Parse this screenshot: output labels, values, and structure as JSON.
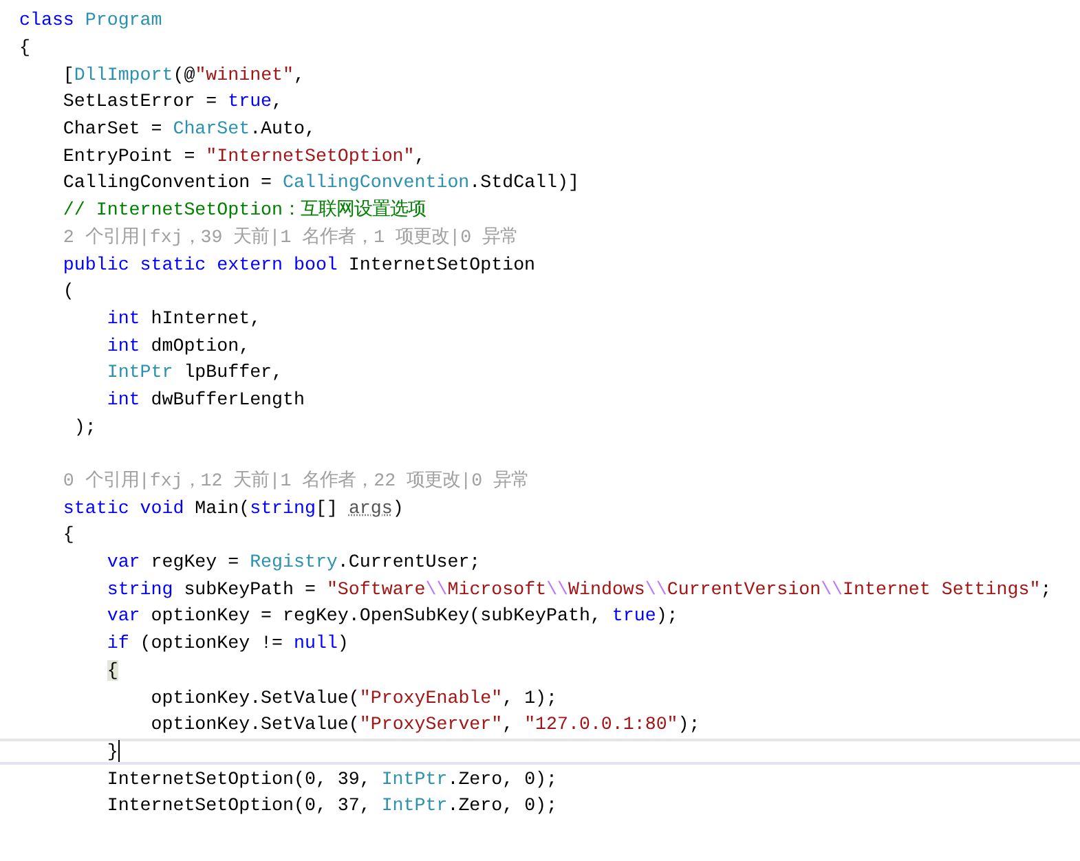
{
  "code_lines": [
    {
      "kind": "code",
      "current": false,
      "tokens": [
        {
          "t": "class",
          "kind": "keyword"
        },
        {
          "t": " Program",
          "kind": "type"
        }
      ]
    },
    {
      "kind": "code",
      "current": false,
      "tokens": [
        {
          "t": "{",
          "kind": "plain"
        }
      ]
    },
    {
      "kind": "code",
      "current": false,
      "tokens": [
        {
          "t": "    [",
          "kind": "plain"
        },
        {
          "t": "DllImport",
          "kind": "type"
        },
        {
          "t": "(@",
          "kind": "plain"
        },
        {
          "t": "\"wininet\"",
          "kind": "string"
        },
        {
          "t": ",",
          "kind": "plain"
        }
      ]
    },
    {
      "kind": "code",
      "current": false,
      "tokens": [
        {
          "t": "    SetLastError = ",
          "kind": "plain"
        },
        {
          "t": "true",
          "kind": "keyword"
        },
        {
          "t": ",",
          "kind": "plain"
        }
      ]
    },
    {
      "kind": "code",
      "current": false,
      "tokens": [
        {
          "t": "    CharSet = ",
          "kind": "plain"
        },
        {
          "t": "CharSet",
          "kind": "type"
        },
        {
          "t": ".Auto,",
          "kind": "plain"
        }
      ]
    },
    {
      "kind": "code",
      "current": false,
      "tokens": [
        {
          "t": "    EntryPoint = ",
          "kind": "plain"
        },
        {
          "t": "\"InternetSetOption\"",
          "kind": "string"
        },
        {
          "t": ",",
          "kind": "plain"
        }
      ]
    },
    {
      "kind": "code",
      "current": false,
      "tokens": [
        {
          "t": "    CallingConvention = ",
          "kind": "plain"
        },
        {
          "t": "CallingConvention",
          "kind": "type"
        },
        {
          "t": ".StdCall)]",
          "kind": "plain"
        }
      ]
    },
    {
      "kind": "code",
      "current": false,
      "tokens": [
        {
          "t": "    // InternetSetOption：互联网设置选项",
          "kind": "comment"
        }
      ]
    },
    {
      "kind": "lens",
      "current": false,
      "text": "    2 个引用|fxj，39 天前|1 名作者，1 项更改|0 异常"
    },
    {
      "kind": "code",
      "current": false,
      "tokens": [
        {
          "t": "    public static extern bool",
          "kind": "keyword"
        },
        {
          "t": " InternetSetOption",
          "kind": "plain"
        }
      ]
    },
    {
      "kind": "code",
      "current": false,
      "tokens": [
        {
          "t": "    (",
          "kind": "plain"
        }
      ]
    },
    {
      "kind": "code",
      "current": false,
      "tokens": [
        {
          "t": "        int",
          "kind": "keyword"
        },
        {
          "t": " hInternet,",
          "kind": "plain"
        }
      ]
    },
    {
      "kind": "code",
      "current": false,
      "tokens": [
        {
          "t": "        int",
          "kind": "keyword"
        },
        {
          "t": " dmOption,",
          "kind": "plain"
        }
      ]
    },
    {
      "kind": "code",
      "current": false,
      "tokens": [
        {
          "t": "        IntPtr",
          "kind": "type"
        },
        {
          "t": " lpBuffer,",
          "kind": "plain"
        }
      ]
    },
    {
      "kind": "code",
      "current": false,
      "tokens": [
        {
          "t": "        int",
          "kind": "keyword"
        },
        {
          "t": " dwBufferLength",
          "kind": "plain"
        }
      ]
    },
    {
      "kind": "code",
      "current": false,
      "tokens": [
        {
          "t": "     );",
          "kind": "plain"
        }
      ]
    },
    {
      "kind": "blank",
      "current": false
    },
    {
      "kind": "lens",
      "current": false,
      "text": "    0 个引用|fxj，12 天前|1 名作者，22 项更改|0 异常"
    },
    {
      "kind": "code",
      "current": false,
      "tokens": [
        {
          "t": "    static void",
          "kind": "keyword"
        },
        {
          "t": " Main(",
          "kind": "plain"
        },
        {
          "t": "string",
          "kind": "keyword"
        },
        {
          "t": "[] ",
          "kind": "plain"
        },
        {
          "t": "args",
          "kind": "unused"
        },
        {
          "t": ")",
          "kind": "plain"
        }
      ]
    },
    {
      "kind": "code",
      "current": false,
      "tokens": [
        {
          "t": "    {",
          "kind": "plain"
        }
      ]
    },
    {
      "kind": "code",
      "current": false,
      "tokens": [
        {
          "t": "        var",
          "kind": "keyword"
        },
        {
          "t": " regKey = ",
          "kind": "plain"
        },
        {
          "t": "Registry",
          "kind": "type"
        },
        {
          "t": ".CurrentUser;",
          "kind": "plain"
        }
      ]
    },
    {
      "kind": "code",
      "current": false,
      "tokens": [
        {
          "t": "        string",
          "kind": "keyword"
        },
        {
          "t": " subKeyPath = ",
          "kind": "plain"
        },
        {
          "t": "\"Software",
          "kind": "string"
        },
        {
          "t": "\\\\",
          "kind": "escape"
        },
        {
          "t": "Microsoft",
          "kind": "string"
        },
        {
          "t": "\\\\",
          "kind": "escape"
        },
        {
          "t": "Windows",
          "kind": "string"
        },
        {
          "t": "\\\\",
          "kind": "escape"
        },
        {
          "t": "CurrentVersion",
          "kind": "string"
        },
        {
          "t": "\\\\",
          "kind": "escape"
        },
        {
          "t": "Internet Settings\"",
          "kind": "string"
        },
        {
          "t": ";",
          "kind": "plain"
        }
      ]
    },
    {
      "kind": "code",
      "current": false,
      "tokens": [
        {
          "t": "        var",
          "kind": "keyword"
        },
        {
          "t": " optionKey = regKey.OpenSubKey(subKeyPath, ",
          "kind": "plain"
        },
        {
          "t": "true",
          "kind": "keyword"
        },
        {
          "t": ");",
          "kind": "plain"
        }
      ]
    },
    {
      "kind": "code",
      "current": false,
      "tokens": [
        {
          "t": "        if",
          "kind": "keyword"
        },
        {
          "t": " (optionKey != ",
          "kind": "plain"
        },
        {
          "t": "null",
          "kind": "keyword"
        },
        {
          "t": ")",
          "kind": "plain"
        }
      ]
    },
    {
      "kind": "code",
      "current": false,
      "tokens": [
        {
          "t": "        {",
          "kind": "brace"
        }
      ]
    },
    {
      "kind": "code",
      "current": false,
      "tokens": [
        {
          "t": "            optionKey.SetValue(",
          "kind": "plain"
        },
        {
          "t": "\"ProxyEnable\"",
          "kind": "string"
        },
        {
          "t": ", 1);",
          "kind": "plain"
        }
      ]
    },
    {
      "kind": "code",
      "current": false,
      "tokens": [
        {
          "t": "            optionKey.SetValue(",
          "kind": "plain"
        },
        {
          "t": "\"ProxyServer\"",
          "kind": "string"
        },
        {
          "t": ", ",
          "kind": "plain"
        },
        {
          "t": "\"127.0.0.1:80\"",
          "kind": "string"
        },
        {
          "t": ");",
          "kind": "plain"
        }
      ]
    },
    {
      "kind": "code",
      "current": true,
      "tokens": [
        {
          "t": "        }",
          "kind": "brace"
        }
      ]
    },
    {
      "kind": "code",
      "current": false,
      "tokens": [
        {
          "t": "        InternetSetOption(0, 39, ",
          "kind": "plain"
        },
        {
          "t": "IntPtr",
          "kind": "type"
        },
        {
          "t": ".Zero, 0);",
          "kind": "plain"
        }
      ]
    },
    {
      "kind": "code",
      "current": false,
      "tokens": [
        {
          "t": "        InternetSetOption(0, 37, ",
          "kind": "plain"
        },
        {
          "t": "IntPtr",
          "kind": "type"
        },
        {
          "t": ".Zero, 0);",
          "kind": "plain"
        }
      ]
    }
  ]
}
